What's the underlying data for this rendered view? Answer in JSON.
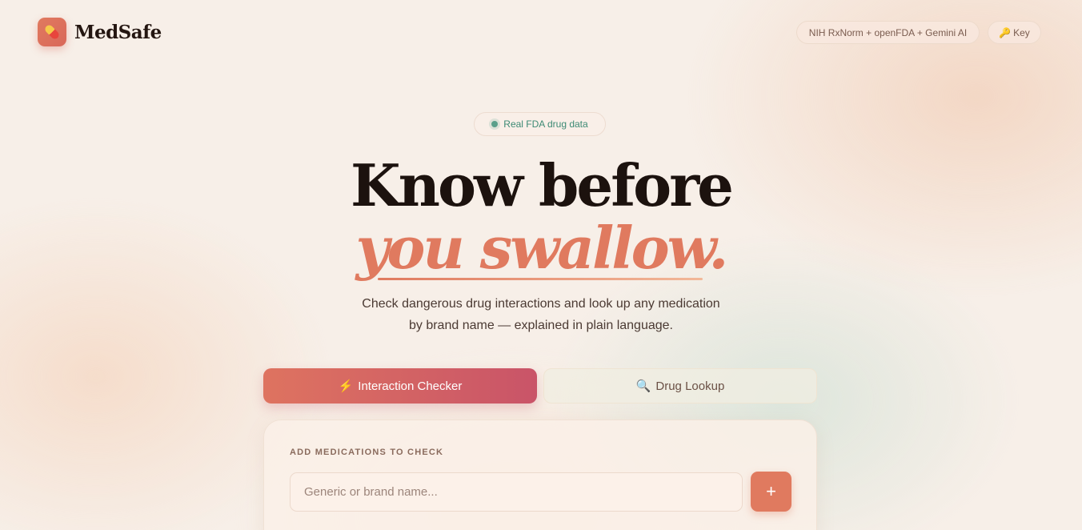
{
  "header": {
    "brand": "MedSafe",
    "logo_icon": "pill-icon",
    "sources_badge": "NIH RxNorm + openFDA + Gemini AI",
    "key_button": {
      "icon": "key-icon",
      "icon_glyph": "🔑",
      "label": "Key"
    }
  },
  "hero": {
    "status_badge": "Real FDA drug data",
    "headline_line1": "Know before",
    "headline_line2": "you swallow.",
    "subtitle_line1": "Check dangerous drug interactions and look up any medication",
    "subtitle_line2": "by brand name — explained in plain language."
  },
  "tabs": [
    {
      "icon": "lightning-icon",
      "icon_glyph": "⚡",
      "label": "Interaction Checker",
      "active": true
    },
    {
      "icon": "search-icon",
      "icon_glyph": "🔍",
      "label": "Drug Lookup",
      "active": false
    }
  ],
  "checker": {
    "section_label": "ADD MEDICATIONS TO CHECK",
    "input_placeholder": "Generic or brand name...",
    "input_value": "",
    "add_button_label": "+"
  },
  "colors": {
    "accent": "#e07a5f",
    "accent_dark": "#c95468",
    "status_green": "#5a9f8a",
    "text_dark": "#1c120e"
  }
}
